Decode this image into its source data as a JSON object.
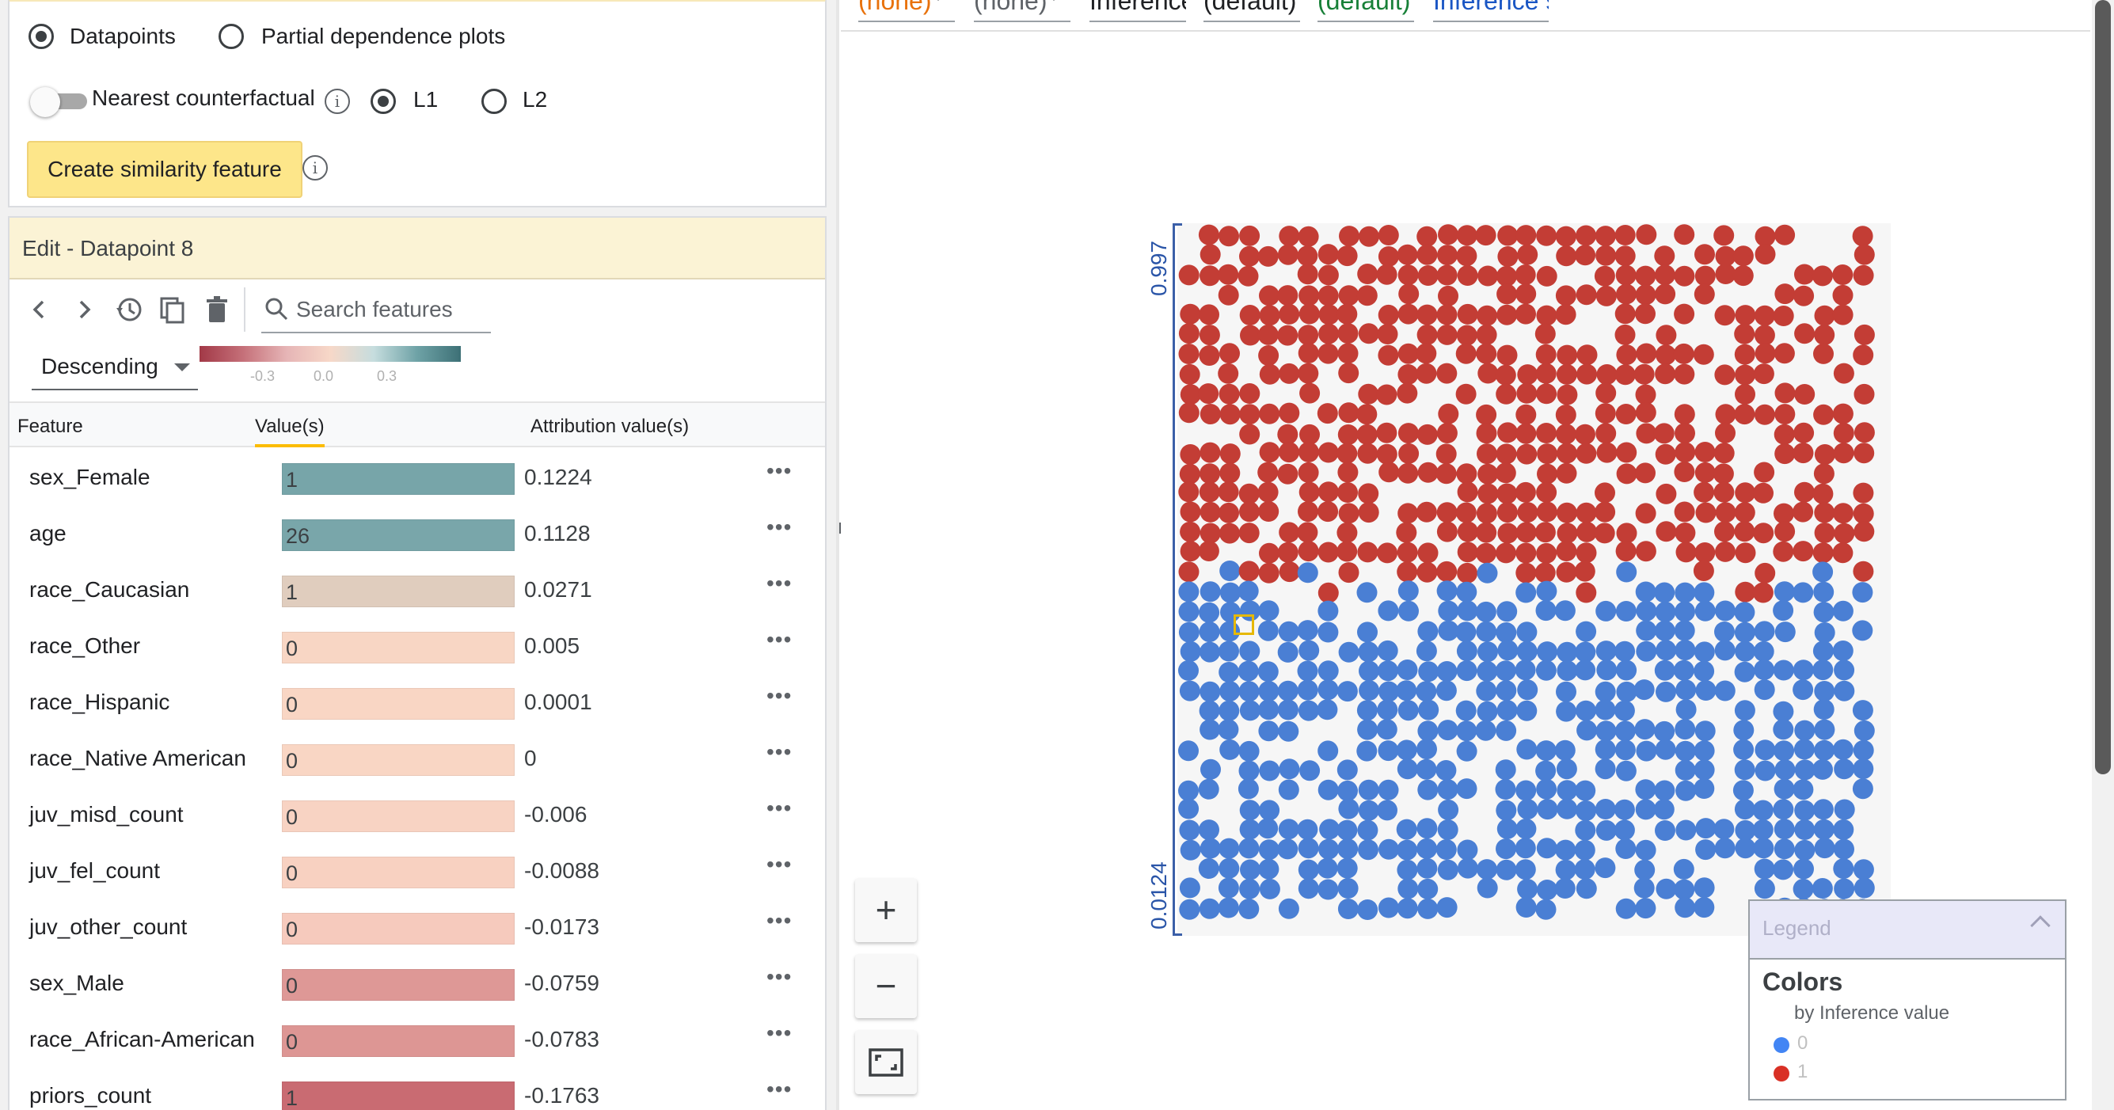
{
  "options": {
    "mode": {
      "datapoints_label": "Datapoints",
      "pdp_label": "Partial dependence plots",
      "selected": "Datapoints"
    },
    "counterfactual": {
      "label": "Nearest counterfactual",
      "enabled": false,
      "l1_label": "L1",
      "l2_label": "L2",
      "selected": "L1"
    },
    "similarity_button": "Create similarity feature"
  },
  "editor": {
    "title": "Edit - Datapoint 8",
    "search_placeholder": "Search features",
    "sort_label": "Descending",
    "gradient_ticks": [
      "-0.3",
      "0.0",
      "0.3"
    ],
    "columns": {
      "feature": "Feature",
      "value": "Value(s)",
      "attribution": "Attribution value(s)"
    },
    "more_label": "•••",
    "rows": [
      {
        "feature": "sex_Female",
        "value": "1",
        "attribution": "0.1224",
        "color": "#77a5a9"
      },
      {
        "feature": "age",
        "value": "26",
        "attribution": "0.1128",
        "color": "#79a6aa"
      },
      {
        "feature": "race_Caucasian",
        "value": "1",
        "attribution": "0.0271",
        "color": "#e0cdbe"
      },
      {
        "feature": "race_Other",
        "value": "0",
        "attribution": "0.005",
        "color": "#f8d6c4"
      },
      {
        "feature": "race_Hispanic",
        "value": "0",
        "attribution": "0.0001",
        "color": "#f9d6c4"
      },
      {
        "feature": "race_Native American",
        "value": "0",
        "attribution": "0",
        "color": "#f9d6c4"
      },
      {
        "feature": "juv_misd_count",
        "value": "0",
        "attribution": "-0.006",
        "color": "#f8d3c3"
      },
      {
        "feature": "juv_fel_count",
        "value": "0",
        "attribution": "-0.0088",
        "color": "#f8d1c1"
      },
      {
        "feature": "juv_other_count",
        "value": "0",
        "attribution": "-0.0173",
        "color": "#f6cabd"
      },
      {
        "feature": "sex_Male",
        "value": "0",
        "attribution": "-0.0759",
        "color": "#de9896"
      },
      {
        "feature": "race_African-American",
        "value": "0",
        "attribution": "-0.0783",
        "color": "#dd9694"
      },
      {
        "feature": "priors_count",
        "value": "1",
        "attribution": "-0.1763",
        "color": "#c96b72"
      }
    ]
  },
  "toolbar": {
    "selects": [
      {
        "label": "(none)",
        "color": "#e8710a"
      },
      {
        "label": "(none)",
        "color": "#5f6368"
      },
      {
        "label": "Inference V",
        "color": "#202124"
      },
      {
        "label": "(default)",
        "color": "#202124"
      },
      {
        "label": "(default)",
        "color": "#188038"
      },
      {
        "label": "Inference s",
        "color": "#1a56c4"
      }
    ]
  },
  "plot": {
    "y_top_label": "0.997",
    "y_bottom_label": "0.0124",
    "colors": {
      "class0": "#4a7fd4",
      "class1": "#c33d35",
      "background": "#f6f6f6"
    }
  },
  "legend": {
    "header": "Legend",
    "title": "Colors",
    "subtitle": "by Inference value",
    "items": [
      {
        "label": "0",
        "color": "#4285f4"
      },
      {
        "label": "1",
        "color": "#d93025"
      }
    ]
  },
  "icons": [
    "chevron-left-icon",
    "chevron-right-icon",
    "history-icon",
    "copy-icon",
    "delete-icon",
    "search-icon",
    "info-icon",
    "zoom-in-icon",
    "zoom-out-icon",
    "fit-screen-icon"
  ]
}
